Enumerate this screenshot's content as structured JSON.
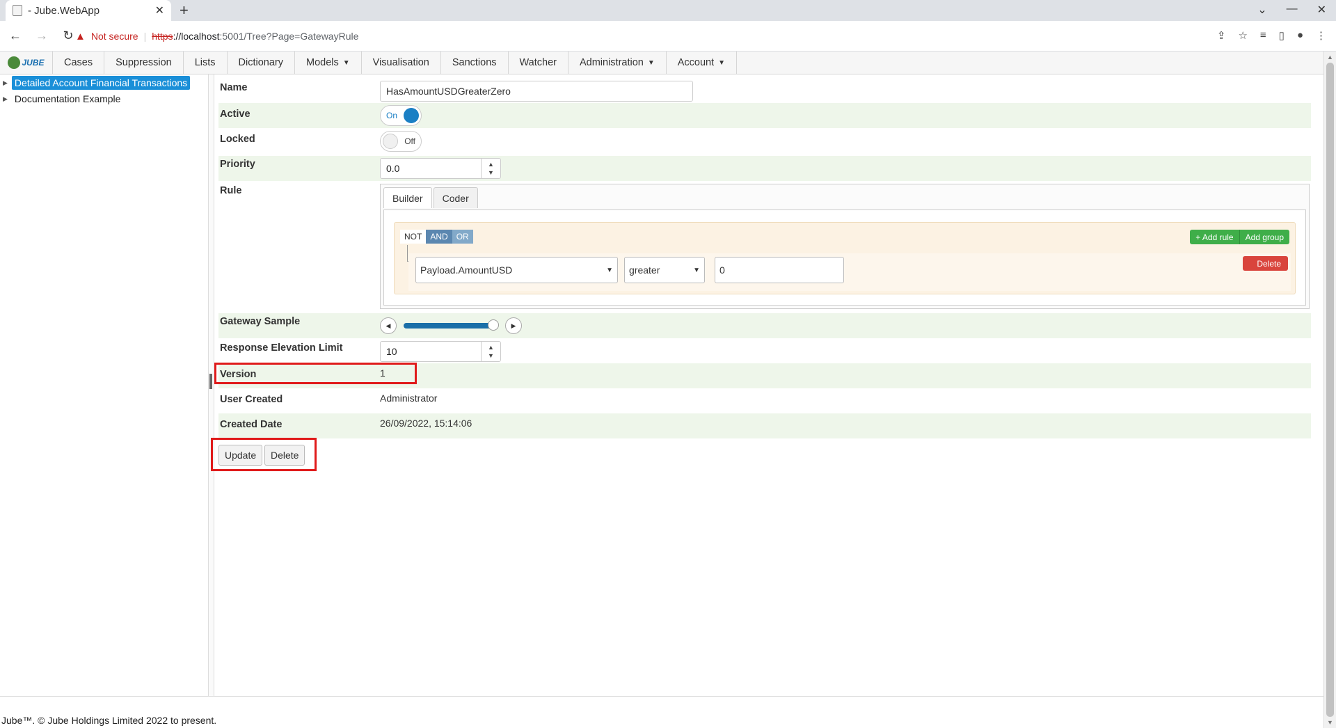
{
  "browser": {
    "tab_title": "- Jube.WebApp",
    "not_secure": "Not secure",
    "url_protocol": "https",
    "url_host": "://localhost",
    "url_path": ":5001/Tree?Page=GatewayRule"
  },
  "nav": {
    "logo": "JUBE",
    "items": [
      "Cases",
      "Suppression",
      "Lists",
      "Dictionary",
      "Models",
      "Visualisation",
      "Sanctions",
      "Watcher",
      "Administration",
      "Account"
    ]
  },
  "tree": {
    "items": [
      "Detailed Account Financial Transactions",
      "Documentation Example"
    ]
  },
  "form": {
    "name_label": "Name",
    "name_value": "HasAmountUSDGreaterZero",
    "active_label": "Active",
    "active_state": "On",
    "locked_label": "Locked",
    "locked_state": "Off",
    "priority_label": "Priority",
    "priority_value": "0.0",
    "rule_label": "Rule",
    "rule_tabs": [
      "Builder",
      "Coder"
    ],
    "rule": {
      "not": "NOT",
      "and": "AND",
      "or": "OR",
      "add_rule": "+ Add rule",
      "add_group": "Add group",
      "field": "Payload.AmountUSD",
      "operator": "greater",
      "value": "0",
      "delete": "Delete"
    },
    "gateway_sample_label": "Gateway Sample",
    "gateway_sample_fraction": 0.95,
    "response_limit_label": "Response Elevation Limit",
    "response_limit_value": "10",
    "version_label": "Version",
    "version_value": "1",
    "user_created_label": "User Created",
    "user_created_value": "Administrator",
    "created_date_label": "Created Date",
    "created_date_value": "26/09/2022, 15:14:06",
    "update_button": "Update",
    "delete_button": "Delete"
  },
  "footer": "Jube™. © Jube Holdings Limited 2022 to present."
}
